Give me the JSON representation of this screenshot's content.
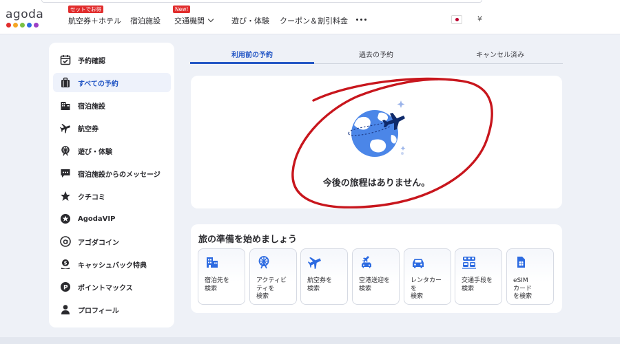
{
  "header": {
    "logo": {
      "text": "agoda",
      "dot_colors": [
        "#e12d2d",
        "#f5a623",
        "#7ac143",
        "#2d6be1",
        "#9b3fc6"
      ]
    },
    "nav": [
      {
        "label": "航空券＋ホテル",
        "badge": "セットでお得"
      },
      {
        "label": "宿泊施設"
      },
      {
        "label": "交通機関",
        "badge": "New!",
        "has_dropdown": true
      },
      {
        "label": "遊び・体験"
      },
      {
        "label": "クーポン＆割引料金"
      }
    ],
    "more_icon": "more-dots-icon",
    "currency": "¥"
  },
  "sidebar": {
    "items": [
      {
        "label": "予約確認",
        "icon": "calendar-check-icon"
      },
      {
        "label": "すべての予約",
        "icon": "luggage-icon",
        "active": true
      },
      {
        "label": "宿泊施設",
        "icon": "building-icon"
      },
      {
        "label": "航空券",
        "icon": "plane-icon"
      },
      {
        "label": "遊び・体験",
        "icon": "ferris-wheel-icon"
      },
      {
        "label": "宿泊施設からのメッセージ",
        "icon": "chat-bubble-icon"
      },
      {
        "label": "クチコミ",
        "icon": "star-icon"
      },
      {
        "label": "AgodaVIP",
        "icon": "vip-star-icon"
      },
      {
        "label": "アゴダコイン",
        "icon": "agoda-coin-icon"
      },
      {
        "label": "キャッシュバック特典",
        "icon": "cashback-icon"
      },
      {
        "label": "ポイントマックス",
        "icon": "pointsmax-icon"
      },
      {
        "label": "プロフィール",
        "icon": "person-icon"
      }
    ]
  },
  "tabs": [
    {
      "label": "利用前の予約",
      "active": true
    },
    {
      "label": "過去の予約"
    },
    {
      "label": "キャンセル済み"
    }
  ],
  "empty_state": {
    "message": "今後の旅程はありません。",
    "illustration": "globe-plane-icon",
    "annotation_color": "#c8161d"
  },
  "prep": {
    "title": "旅の準備を始めましょう",
    "tiles": [
      {
        "label": "宿泊先を\n検索",
        "icon": "hotel-icon"
      },
      {
        "label": "アクティビ\nティを\n検索",
        "icon": "ferris-wheel-icon"
      },
      {
        "label": "航空券を\n検索",
        "icon": "plane-icon"
      },
      {
        "label": "空港送迎を\n検索",
        "icon": "airport-transfer-icon"
      },
      {
        "label": "レンタカー\nを\n検索",
        "icon": "car-icon"
      },
      {
        "label": "交通手段を\n検索",
        "icon": "train-bus-icon"
      },
      {
        "label": "eSIM\nカード\nを検索",
        "icon": "esim-icon"
      }
    ]
  },
  "colors": {
    "accent": "#2457c5",
    "badge": "#e12d2d",
    "icon_blue": "#2d6be1"
  }
}
